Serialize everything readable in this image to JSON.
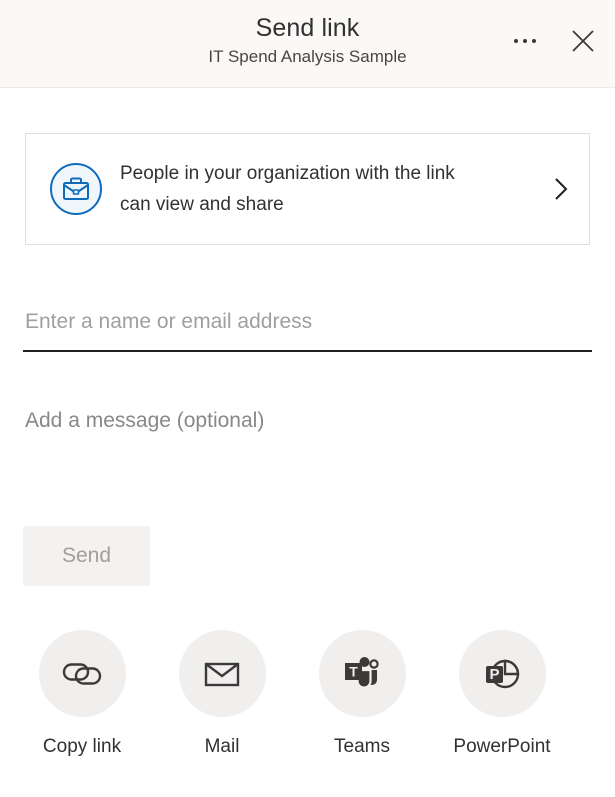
{
  "header": {
    "title": "Send link",
    "subtitle": "IT Spend Analysis Sample",
    "more_options_label": "More options",
    "close_label": "Close"
  },
  "link_settings": {
    "icon": "briefcase-icon",
    "line1": "People in your organization with the link",
    "line2": "can view and share",
    "chevron": "chevron-right-icon",
    "icon_color": "#0f6cbd"
  },
  "form": {
    "recipients": {
      "value": "",
      "placeholder": "Enter a name or email address"
    },
    "message": {
      "value": "",
      "placeholder": "Add a message (optional)"
    },
    "send_label": "Send",
    "send_disabled": true
  },
  "share_options": [
    {
      "label": "Copy link",
      "icon": "link-icon"
    },
    {
      "label": "Mail",
      "icon": "mail-icon"
    },
    {
      "label": "Teams",
      "icon": "teams-icon"
    },
    {
      "label": "PowerPoint",
      "icon": "powerpoint-icon"
    }
  ],
  "colors": {
    "header_background": "#faf9f8",
    "accent": "#0f6cbd",
    "icon_gray": "#3b3a39",
    "disabled_text": "#a19f9d"
  }
}
